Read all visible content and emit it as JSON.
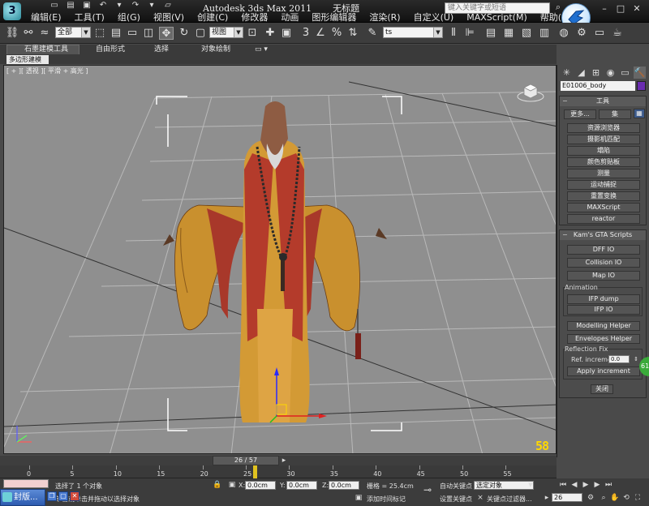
{
  "window": {
    "app_title": "Autodesk 3ds Max  2011",
    "doc_title": "无标题",
    "search_placeholder": "键入关键字或短语"
  },
  "menu": [
    "编辑(E)",
    "工具(T)",
    "组(G)",
    "视图(V)",
    "创建(C)",
    "修改器",
    "动画",
    "图形编辑器",
    "渲染(R)",
    "自定义(U)",
    "MAXScript(M)",
    "帮助(H)"
  ],
  "toolbar": {
    "selection_filter": "全部",
    "ref_coord": "视图",
    "named_selection": "ts",
    "snap_label": "3"
  },
  "ribbon": {
    "tabs": [
      "石墨建模工具",
      "自由形式",
      "选择",
      "对象绘制"
    ],
    "sub_tab": "多边形建模"
  },
  "viewport": {
    "label": "[ + ][ 透视 ][ 平滑 + 高光 ]",
    "frame_overlay": "58"
  },
  "command_panel": {
    "object_name": "E01006_body",
    "object_color": "#6a2cb0",
    "utilities_title": "工具",
    "more_button": "更多...",
    "sets_button": "集",
    "utility_buttons": [
      "资源浏览器",
      "摄影机匹配",
      "塌陷",
      "颜色剪贴板",
      "测量",
      "运动捕捉",
      "重置变换",
      "MAXScript",
      "reactor"
    ],
    "scripts_title": "Kam's GTA Scripts",
    "script_buttons": [
      "DFF IO",
      "Collision IO",
      "Map IO"
    ],
    "animation_label": "Animation",
    "animation_buttons": [
      "IFP dump",
      "IFP IO"
    ],
    "helper_buttons": [
      "Modelling Helper",
      "Envelopes Helper"
    ],
    "reflection_label": "Reflection Fix",
    "ref_increment_label": "Ref. increment",
    "ref_increment_value": "0.0",
    "apply_button": "Apply increment",
    "close_button": "关闭"
  },
  "timeline": {
    "current": "26 / 57",
    "ticks": [
      "0",
      "5",
      "10",
      "15",
      "20",
      "25",
      "30",
      "35",
      "40",
      "45",
      "50",
      "55"
    ],
    "frame_value": 26
  },
  "status": {
    "selected": "选择了 1 个对象",
    "prompt": "单击或单击并拖动以选择对象",
    "x_label": "X:",
    "x_value": "0.0cm",
    "y_label": "Y:",
    "y_value": "0.0cm",
    "z_label": "Z:",
    "z_value": "0.0cm",
    "grid": "栅格 = 25.4cm",
    "add_time_tag": "添加时间标记",
    "auto_key": "自动关键点",
    "selected_obj": "选定对象",
    "set_key": "设置关键点",
    "key_filter": "关键点过滤器...",
    "frame": "26",
    "taskbar_app": "封版...",
    "status_badge": "61"
  }
}
